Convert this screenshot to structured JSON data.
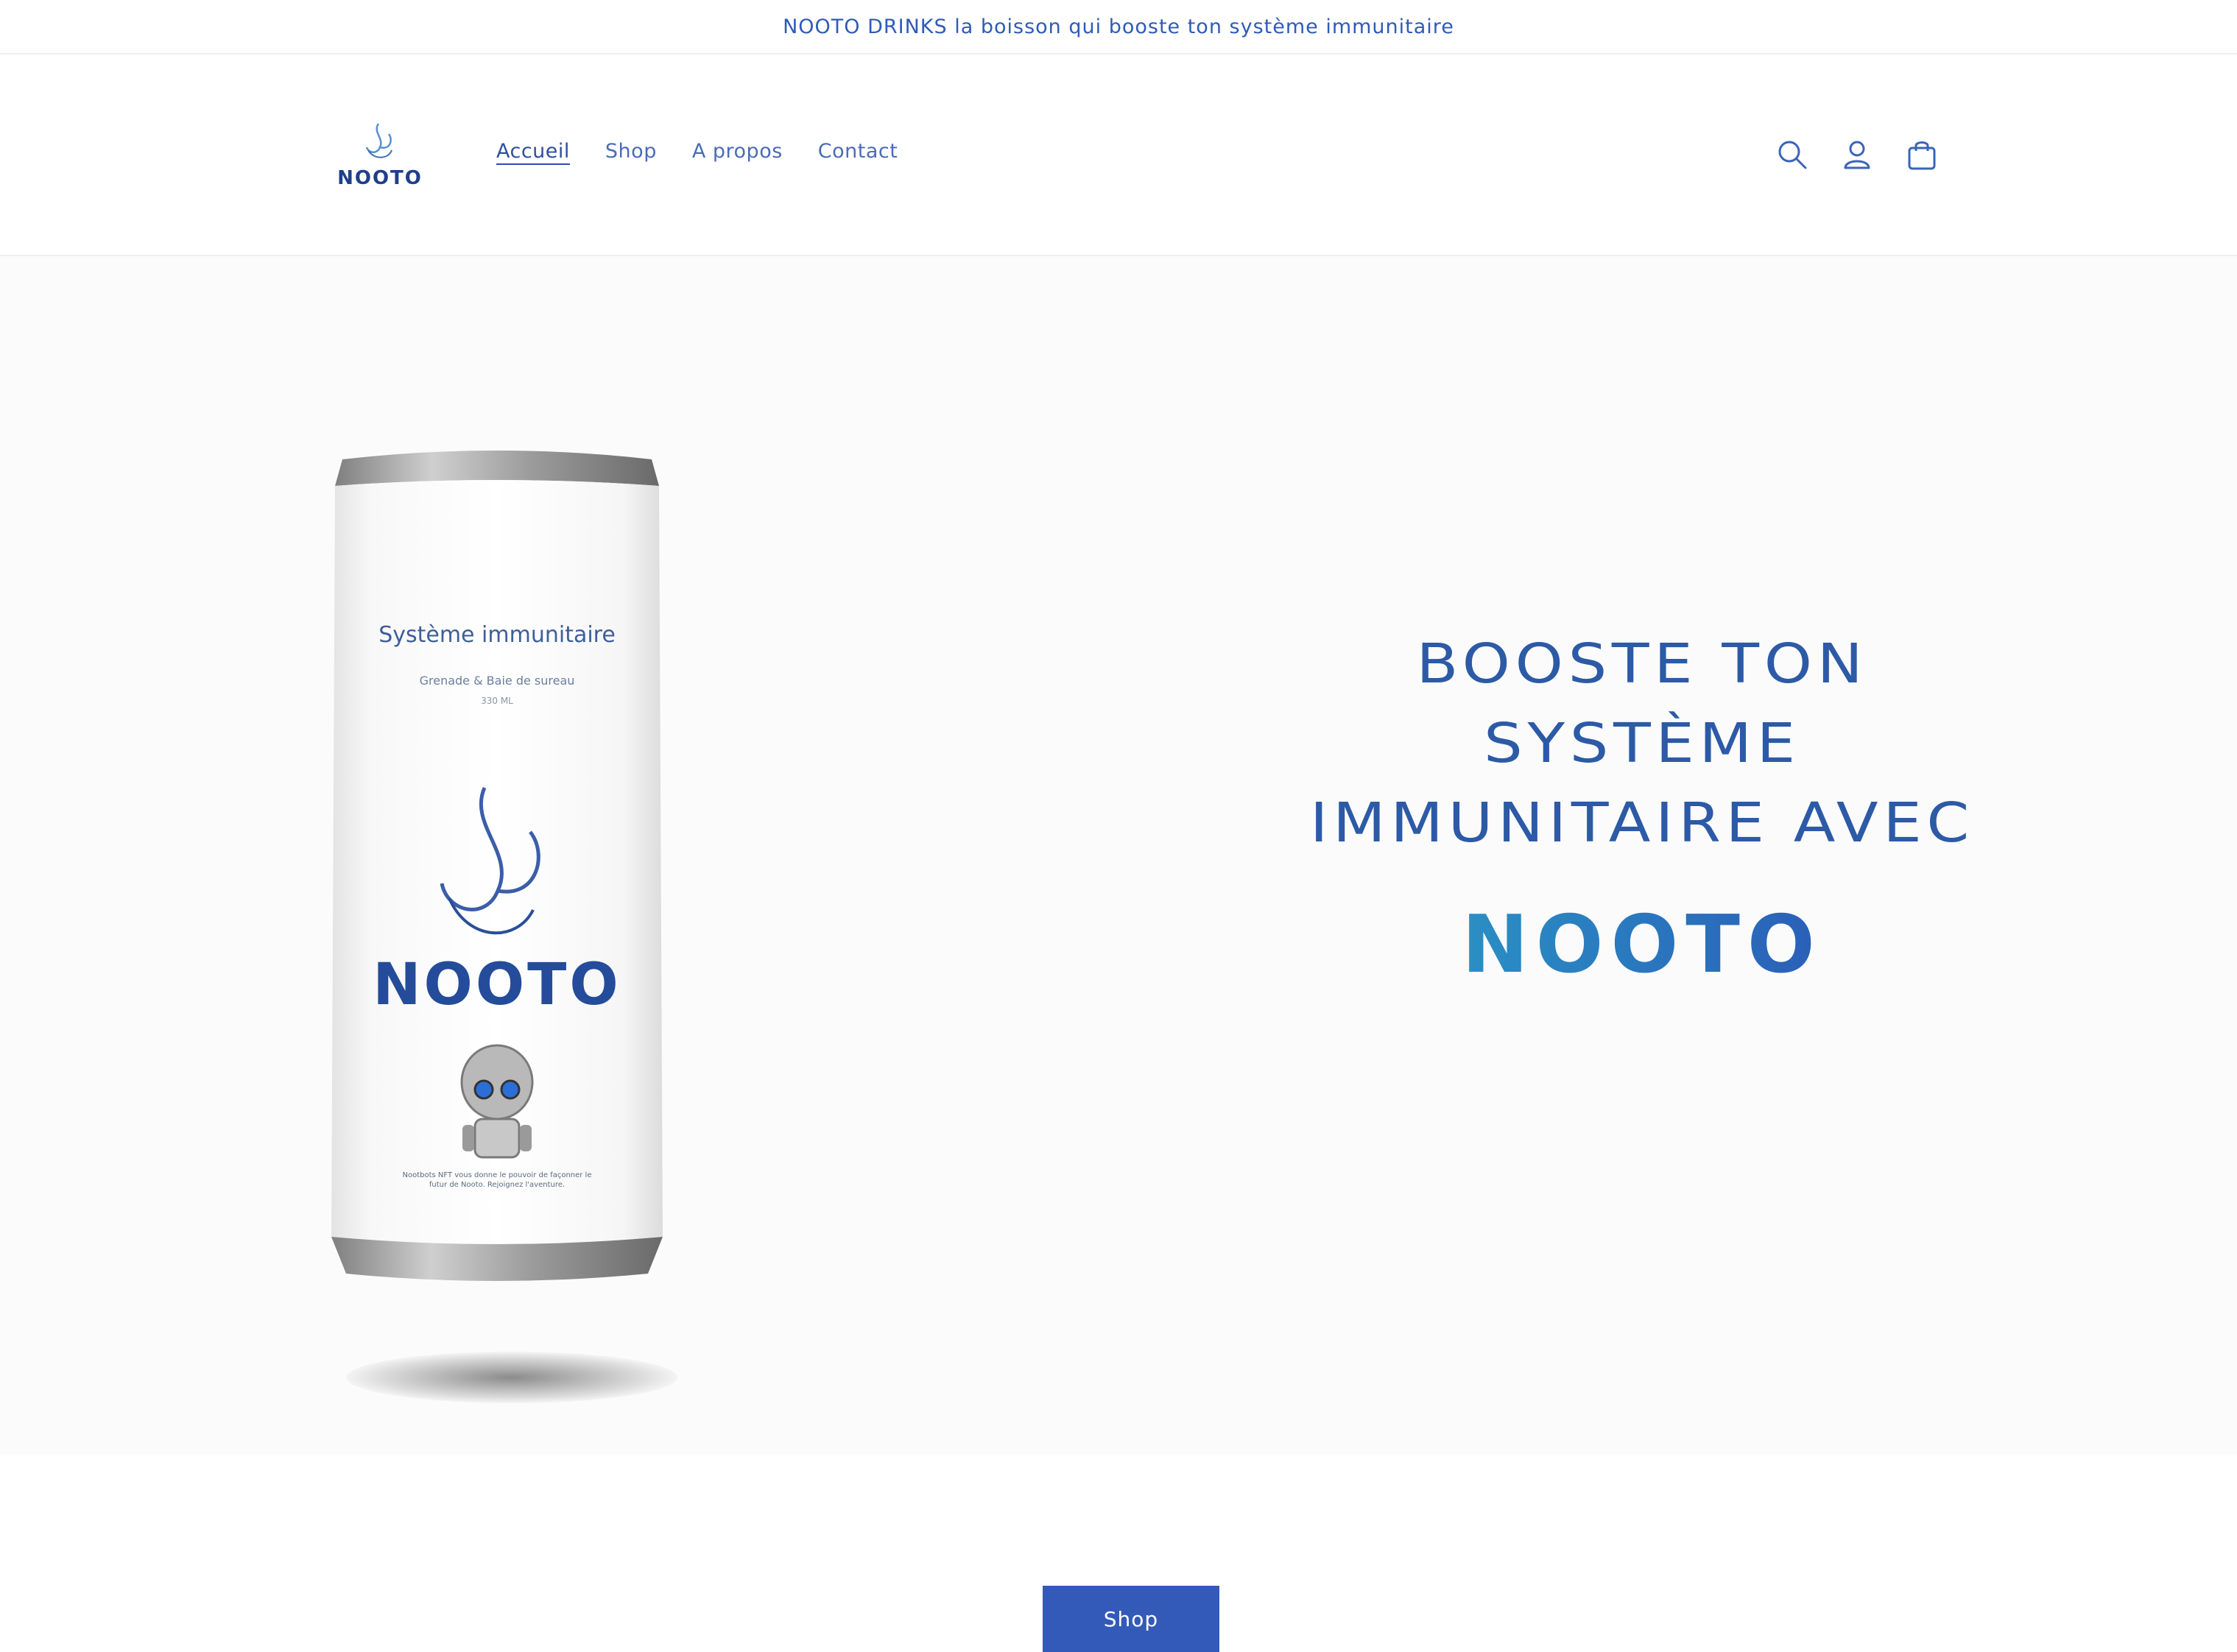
{
  "announcement": {
    "text": "NOOTO DRINKS la boisson qui booste ton système immunitaire"
  },
  "header": {
    "logo_text": "NOOTO",
    "nav": [
      {
        "label": "Accueil",
        "active": true
      },
      {
        "label": "Shop",
        "active": false
      },
      {
        "label": "A propos",
        "active": false
      },
      {
        "label": "Contact",
        "active": false
      }
    ],
    "icons": [
      "search-icon",
      "account-icon",
      "cart-icon"
    ]
  },
  "hero": {
    "can": {
      "title": "Système immunitaire",
      "subtitle": "Grenade & Baie de sureau",
      "volume": "330 ML",
      "brand": "NOOTO",
      "footer_text": "Nootbots NFT vous donne le pouvoir de façonner le futur de Nooto. Rejoignez l'aventure."
    },
    "headline_lines": [
      "BOOSTE TON",
      "SYSTÈME",
      "IMMUNITAIRE AVEC"
    ],
    "brand": "NOOTO",
    "cta_label": "Shop"
  },
  "colors": {
    "accent": "#335ab8",
    "text": "#2f5bb7",
    "headline": "#2c5aa6",
    "brand_gradient_start": "#2a8fc4",
    "brand_gradient_end": "#2a5fb8"
  }
}
